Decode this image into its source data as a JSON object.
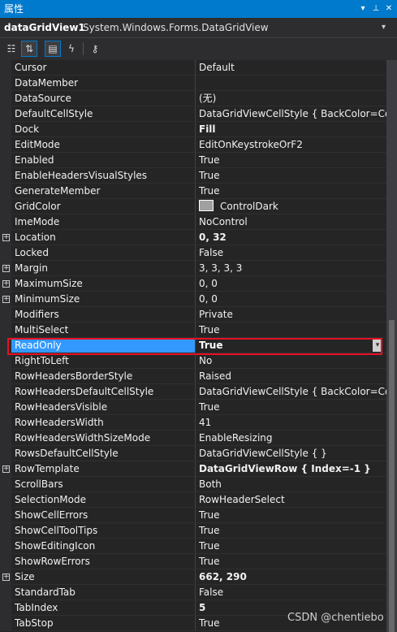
{
  "panel": {
    "title": "属性",
    "controls": {
      "dropdown": "▾",
      "pin": "⊥",
      "close": "✕"
    }
  },
  "object_selector": {
    "name": "dataGridView1",
    "type": "System.Windows.Forms.DataGridView",
    "dropdown": "▾"
  },
  "toolbar": {
    "buttons": [
      {
        "icon": "categorized-icon",
        "glyph": "☷",
        "active": false
      },
      {
        "icon": "alphabetical-icon",
        "glyph": "⇅",
        "active": true
      },
      {
        "icon": "properties-icon",
        "glyph": "▤",
        "active": true
      },
      {
        "icon": "events-icon",
        "glyph": "ϟ",
        "active": false
      },
      {
        "icon": "property-pages-icon",
        "glyph": "⚷",
        "active": false
      }
    ]
  },
  "expand_glyph": "+",
  "properties": [
    {
      "name": "Cursor",
      "value": "Default"
    },
    {
      "name": "DataMember",
      "value": ""
    },
    {
      "name": "DataSource",
      "value": "(无)"
    },
    {
      "name": "DefaultCellStyle",
      "value": "DataGridViewCellStyle { BackColor=Color"
    },
    {
      "name": "Dock",
      "value": "Fill",
      "bold": true
    },
    {
      "name": "EditMode",
      "value": "EditOnKeystrokeOrF2"
    },
    {
      "name": "Enabled",
      "value": "True"
    },
    {
      "name": "EnableHeadersVisualStyles",
      "value": "True"
    },
    {
      "name": "GenerateMember",
      "value": "True"
    },
    {
      "name": "GridColor",
      "value": "ControlDark",
      "swatch": "#a0a0a0"
    },
    {
      "name": "ImeMode",
      "value": "NoControl"
    },
    {
      "name": "Location",
      "value": "0, 32",
      "bold": true,
      "expandable": true
    },
    {
      "name": "Locked",
      "value": "False"
    },
    {
      "name": "Margin",
      "value": "3, 3, 3, 3",
      "expandable": true
    },
    {
      "name": "MaximumSize",
      "value": "0, 0",
      "expandable": true
    },
    {
      "name": "MinimumSize",
      "value": "0, 0",
      "expandable": true
    },
    {
      "name": "Modifiers",
      "value": "Private"
    },
    {
      "name": "MultiSelect",
      "value": "True"
    },
    {
      "name": "ReadOnly",
      "value": "True",
      "selected": true
    },
    {
      "name": "RightToLeft",
      "value": "No"
    },
    {
      "name": "RowHeadersBorderStyle",
      "value": "Raised"
    },
    {
      "name": "RowHeadersDefaultCellStyle",
      "value": "DataGridViewCellStyle { BackColor=Color"
    },
    {
      "name": "RowHeadersVisible",
      "value": "True"
    },
    {
      "name": "RowHeadersWidth",
      "value": "41"
    },
    {
      "name": "RowHeadersWidthSizeMode",
      "value": "EnableResizing"
    },
    {
      "name": "RowsDefaultCellStyle",
      "value": "DataGridViewCellStyle { }"
    },
    {
      "name": "RowTemplate",
      "value": "DataGridViewRow { Index=-1 }",
      "bold": true,
      "expandable": true
    },
    {
      "name": "ScrollBars",
      "value": "Both"
    },
    {
      "name": "SelectionMode",
      "value": "RowHeaderSelect"
    },
    {
      "name": "ShowCellErrors",
      "value": "True"
    },
    {
      "name": "ShowCellToolTips",
      "value": "True"
    },
    {
      "name": "ShowEditingIcon",
      "value": "True"
    },
    {
      "name": "ShowRowErrors",
      "value": "True"
    },
    {
      "name": "Size",
      "value": "662, 290",
      "bold": true,
      "expandable": true
    },
    {
      "name": "StandardTab",
      "value": "False"
    },
    {
      "name": "TabIndex",
      "value": "5",
      "bold": true
    },
    {
      "name": "TabStop",
      "value": "True"
    }
  ],
  "selected_dropdown": "▾",
  "watermark": "CSDN @chentiebo"
}
